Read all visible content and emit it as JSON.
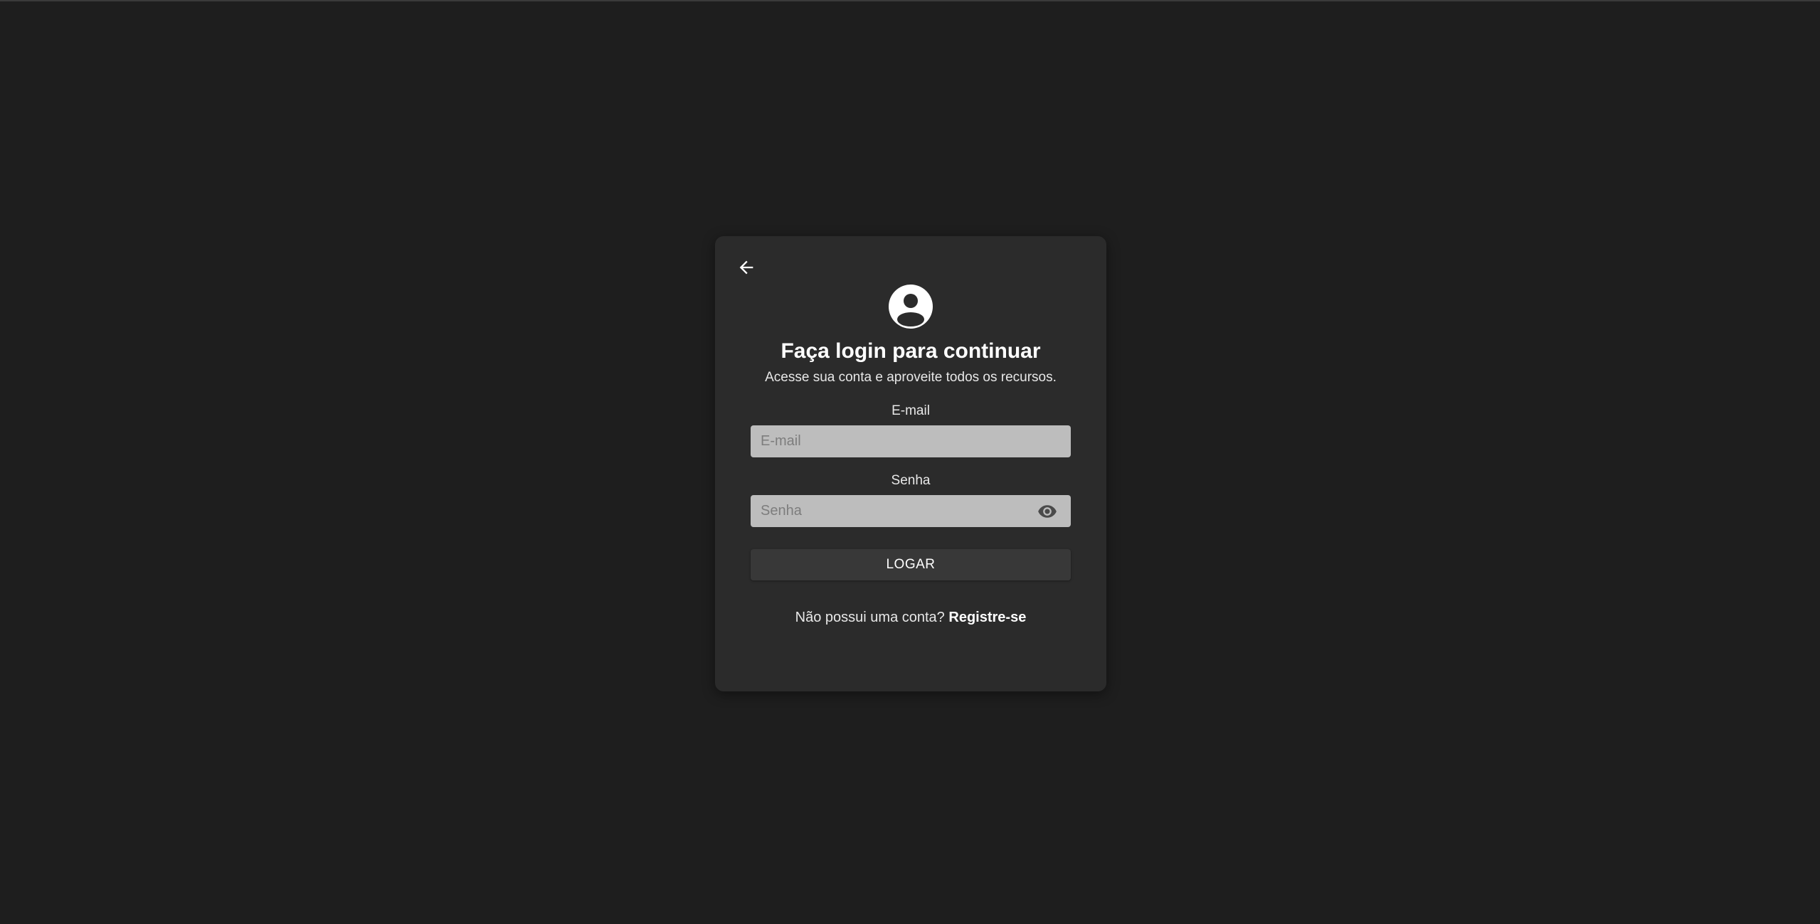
{
  "login": {
    "title": "Faça login para continuar",
    "subtitle": "Acesse sua conta e aproveite todos os recursos.",
    "email": {
      "label": "E-mail",
      "placeholder": "E-mail",
      "value": ""
    },
    "password": {
      "label": "Senha",
      "placeholder": "Senha",
      "value": ""
    },
    "submit_label": "LOGAR",
    "register_prompt": "Não possui uma conta?",
    "register_link": "Registre-se"
  },
  "icons": {
    "back": "arrow-left-icon",
    "avatar": "account-circle-icon",
    "toggle_password": "eye-icon"
  },
  "colors": {
    "background": "#1e1e1e",
    "card": "#2b2b2b",
    "input": "#bdbdbd",
    "button": "#383838",
    "text": "#ffffff"
  }
}
